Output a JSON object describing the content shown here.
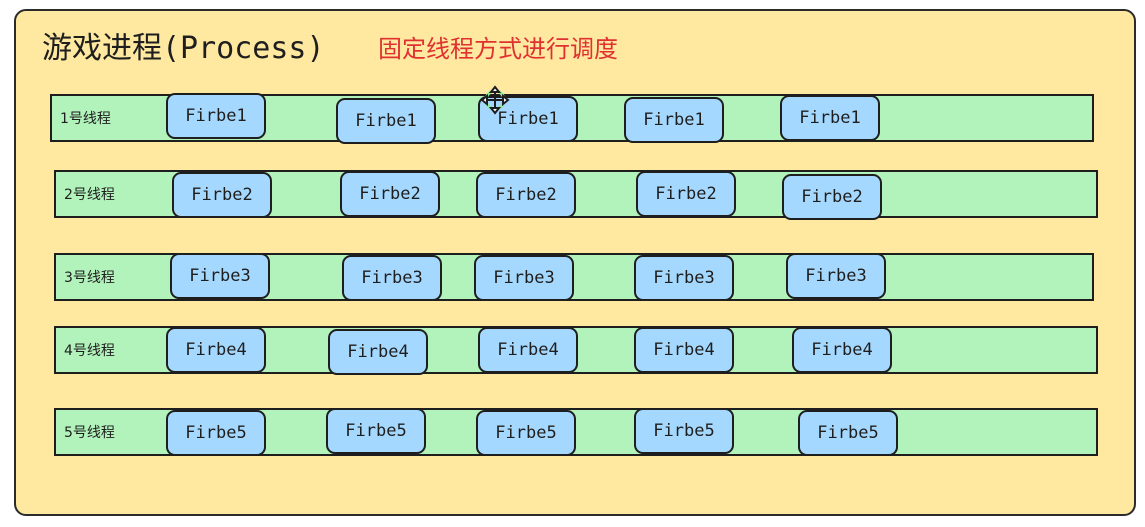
{
  "process": {
    "title": "游戏进程(Process)",
    "subtitle": "固定线程方式进行调度",
    "colors": {
      "process_fill": "#ffe9a0",
      "thread_fill": "#b2f2bb",
      "fiber_fill": "#a5d8ff",
      "subtitle": "#e03131",
      "stroke": "#1e1e1e"
    }
  },
  "threads": [
    {
      "label": "1号线程",
      "fibers": [
        "Firbe1",
        "Firbe1",
        "Firbe1",
        "Firbe1",
        "Firbe1"
      ]
    },
    {
      "label": "2号线程",
      "fibers": [
        "Firbe2",
        "Firbe2",
        "Firbe2",
        "Firbe2",
        "Firbe2"
      ]
    },
    {
      "label": "3号线程",
      "fibers": [
        "Firbe3",
        "Firbe3",
        "Firbe3",
        "Firbe3",
        "Firbe3"
      ]
    },
    {
      "label": "4号线程",
      "fibers": [
        "Firbe4",
        "Firbe4",
        "Firbe4",
        "Firbe4",
        "Firbe4"
      ]
    },
    {
      "label": "5号线程",
      "fibers": [
        "Firbe5",
        "Firbe5",
        "Firbe5",
        "Firbe5",
        "Firbe5"
      ]
    }
  ],
  "cursor_icon": "move-cursor-icon"
}
